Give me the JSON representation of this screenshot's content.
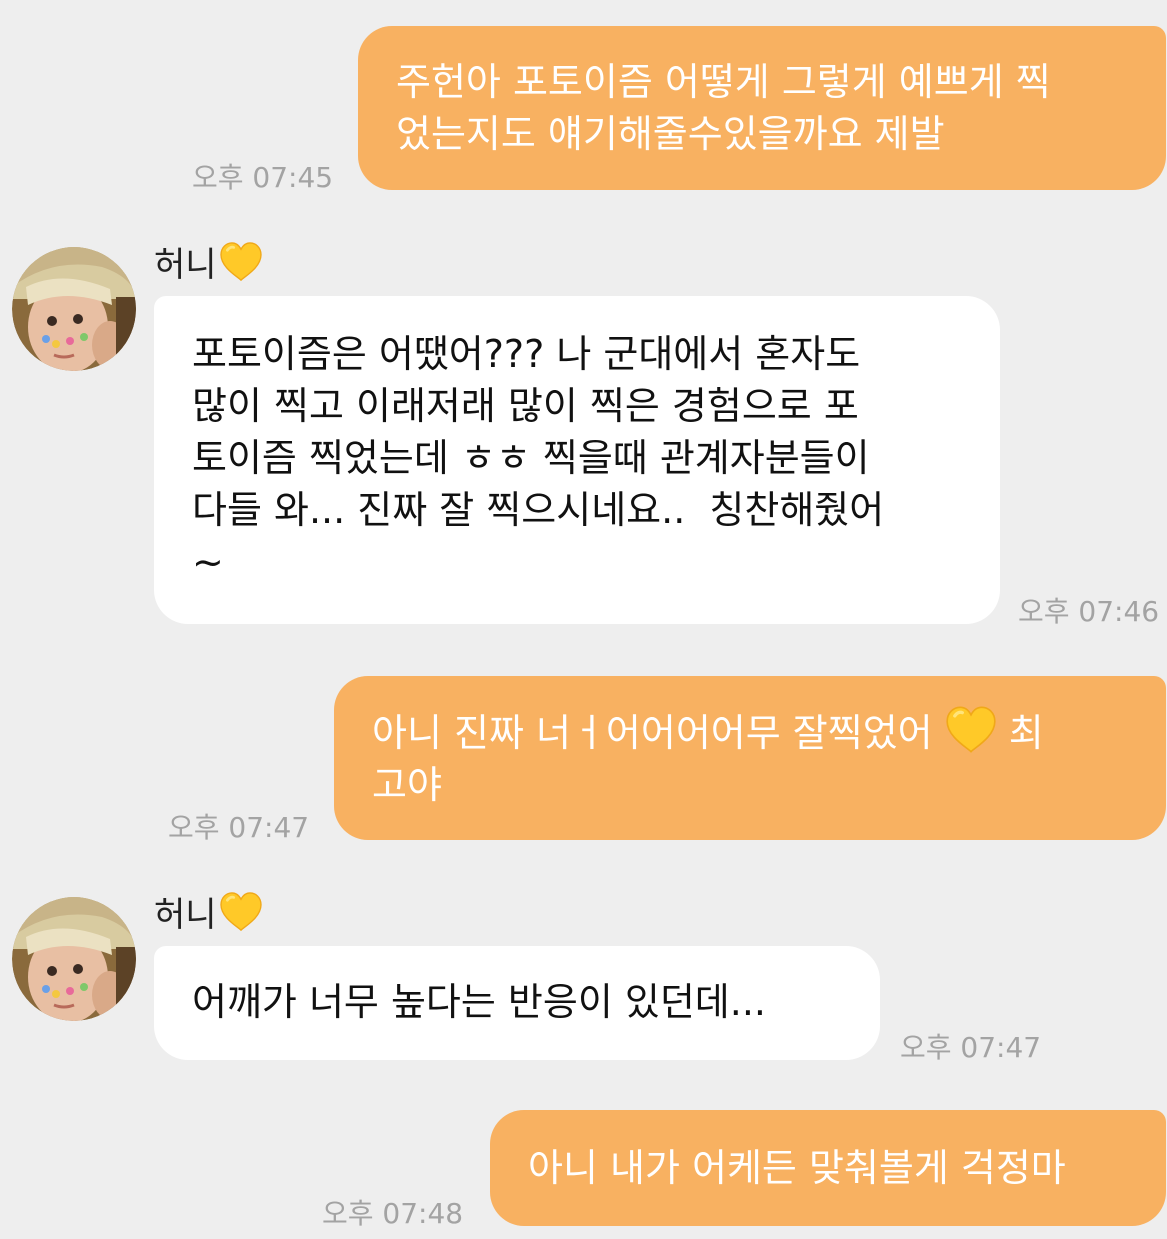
{
  "colors": {
    "background": "#eeeeee",
    "outgoing_bubble": "#f8b161",
    "incoming_bubble": "#ffffff",
    "outgoing_text": "#ffffff",
    "incoming_text": "#111111",
    "timestamp": "#a3a3a3",
    "heart": "#ffc928"
  },
  "messages": [
    {
      "direction": "outgoing",
      "text": "주헌아 포토이즘 어떻게 그렇게 예쁘게 찍\n었는지도 얘기해줄수있을까요 제발",
      "time": "오후 07:45"
    },
    {
      "direction": "incoming",
      "sender": "허니",
      "sender_icon": "yellow-heart-icon",
      "text": "포토이즘은 어땠어??? 나 군대에서 혼자도\n많이 찍고 이래저래 많이 찍은 경험으로 포\n토이즘 찍었는데 ㅎㅎ 찍을때 관계자분들이\n다들 와... 진짜 잘 찍으시네요..  칭찬해줬어\n~",
      "time": "오후 07:46"
    },
    {
      "direction": "outgoing",
      "text_before_emoji": "아니 진짜 너ㅓ어어어어무 잘찍었어 ",
      "emoji": "yellow-heart-icon",
      "text_after_emoji": " 최\n고야",
      "time": "오후 07:47"
    },
    {
      "direction": "incoming",
      "sender": "허니",
      "sender_icon": "yellow-heart-icon",
      "text": "어깨가 너무 높다는 반응이 있던데...",
      "time": "오후 07:47"
    },
    {
      "direction": "outgoing",
      "text": "아니 내가 어케든 맞춰볼게 걱정마",
      "time": "오후 07:48"
    }
  ]
}
